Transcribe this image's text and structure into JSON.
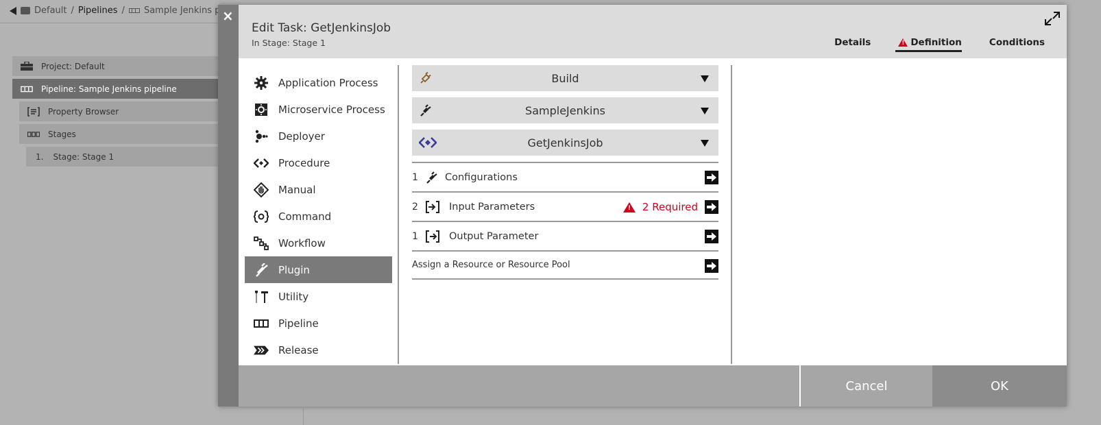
{
  "background": {
    "breadcrumb": {
      "project": "Default",
      "sep1": "/",
      "pipelines": "Pipelines",
      "sep2": "/",
      "pipeline": "Sample Jenkins pipe"
    },
    "tree": [
      {
        "label": "Project: Default",
        "icon": "briefcase-icon"
      },
      {
        "label": "Pipeline: Sample Jenkins pipeline",
        "icon": "pipeline-icon",
        "selected": true
      },
      {
        "label": "Property Browser",
        "icon": "property-browser-icon"
      },
      {
        "label": "Stages",
        "icon": "stages-icon"
      },
      {
        "label": "Stage: Stage 1",
        "index": "1."
      }
    ]
  },
  "modal": {
    "close_label": "×",
    "title": "Edit Task: GetJenkinsJob",
    "subtitle": "In Stage: Stage 1",
    "tabs": [
      {
        "label": "Details"
      },
      {
        "label": "Definition",
        "active": true,
        "warning": true
      },
      {
        "label": "Conditions"
      }
    ],
    "task_types": [
      {
        "label": "Application Process",
        "icon": "gear-icon"
      },
      {
        "label": "Microservice Process",
        "icon": "microservice-icon"
      },
      {
        "label": "Deployer",
        "icon": "deployer-icon"
      },
      {
        "label": "Procedure",
        "icon": "procedure-icon"
      },
      {
        "label": "Manual",
        "icon": "manual-hand-icon"
      },
      {
        "label": "Command",
        "icon": "command-icon"
      },
      {
        "label": "Workflow",
        "icon": "workflow-icon"
      },
      {
        "label": "Plugin",
        "icon": "plug-icon",
        "selected": true
      },
      {
        "label": "Utility",
        "icon": "utility-tools-icon"
      },
      {
        "label": "Pipeline",
        "icon": "pipeline-icon"
      },
      {
        "label": "Release",
        "icon": "release-icon"
      }
    ],
    "dropdowns": [
      {
        "label": "Build",
        "icon": "build-plug-icon",
        "icon_color": "#8a5a2b"
      },
      {
        "label": "SampleJenkins",
        "icon": "plug-icon",
        "icon_color": "#222222"
      },
      {
        "label": "GetJenkinsJob",
        "icon": "procedure-icon",
        "icon_color": "#3a3a9a"
      }
    ],
    "sections": [
      {
        "count": "1",
        "label": "Configurations",
        "icon": "plug-icon"
      },
      {
        "count": "2",
        "label": "Input Parameters",
        "icon": "input-params-icon",
        "required": "2 Required"
      },
      {
        "count": "1",
        "label": "Output Parameter",
        "icon": "output-params-icon"
      },
      {
        "label": "Assign a Resource or Resource Pool"
      }
    ],
    "footer": {
      "cancel_label": "Cancel",
      "ok_label": "OK"
    },
    "colors": {
      "warning": "#d0021b",
      "selected_bg": "#7a7a7a",
      "header_bg": "#dcdcdc"
    }
  }
}
